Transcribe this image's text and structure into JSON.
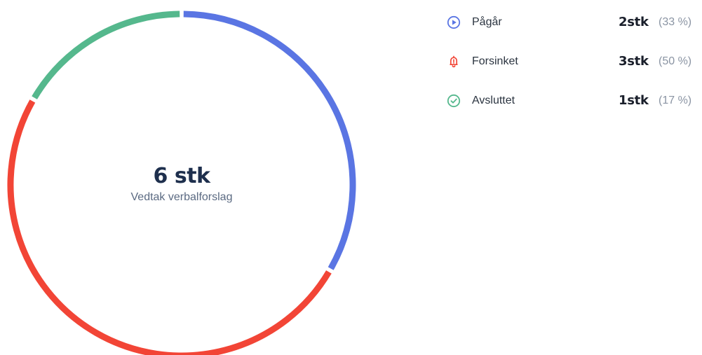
{
  "colors": {
    "in_progress": "#5a75e3",
    "delayed": "#f24536",
    "completed": "#55b88d",
    "text_dark": "#1e2f4d",
    "text_muted": "#8a94a3"
  },
  "center": {
    "total": "6 stk",
    "subtitle": "Vedtak verbalforslag"
  },
  "legend": [
    {
      "label": "Pågår",
      "count": "2stk",
      "percent": "(33 %)",
      "icon": "play-circle-icon"
    },
    {
      "label": "Forsinket",
      "count": "3stk",
      "percent": "(50 %)",
      "icon": "bell-alert-icon"
    },
    {
      "label": "Avsluttet",
      "count": "1stk",
      "percent": "(17 %)",
      "icon": "check-circle-icon"
    }
  ],
  "chart_data": {
    "type": "pie",
    "donut": true,
    "categories": [
      "Pågår",
      "Forsinket",
      "Avsluttet"
    ],
    "values": [
      2,
      3,
      1
    ],
    "colors": [
      "#5a75e3",
      "#f24536",
      "#55b88d"
    ],
    "total": 6
  }
}
